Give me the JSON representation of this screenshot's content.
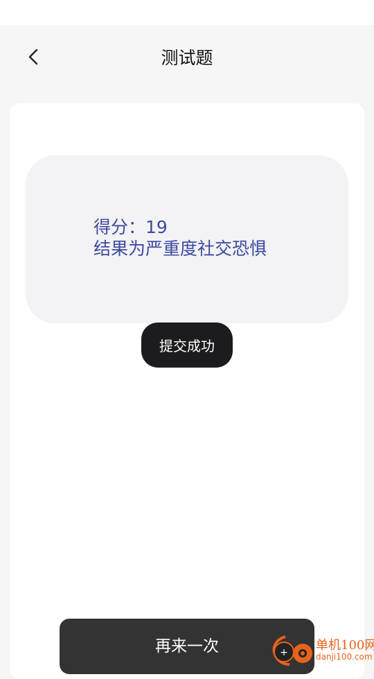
{
  "header": {
    "title": "测试题",
    "back_icon": "chevron-left-icon"
  },
  "result": {
    "score_line": "得分：19",
    "result_line": "结果为严重度社交恐惧"
  },
  "toast": {
    "text": "提交成功"
  },
  "footer": {
    "retry_label": "再来一次"
  },
  "watermark": {
    "name": "单机100网",
    "url": "danji100.com"
  },
  "colors": {
    "accent_text": "#3d4aa0",
    "button_bg": "#333333",
    "toast_bg": "#1c1c1e",
    "watermark": "#e8621c"
  }
}
